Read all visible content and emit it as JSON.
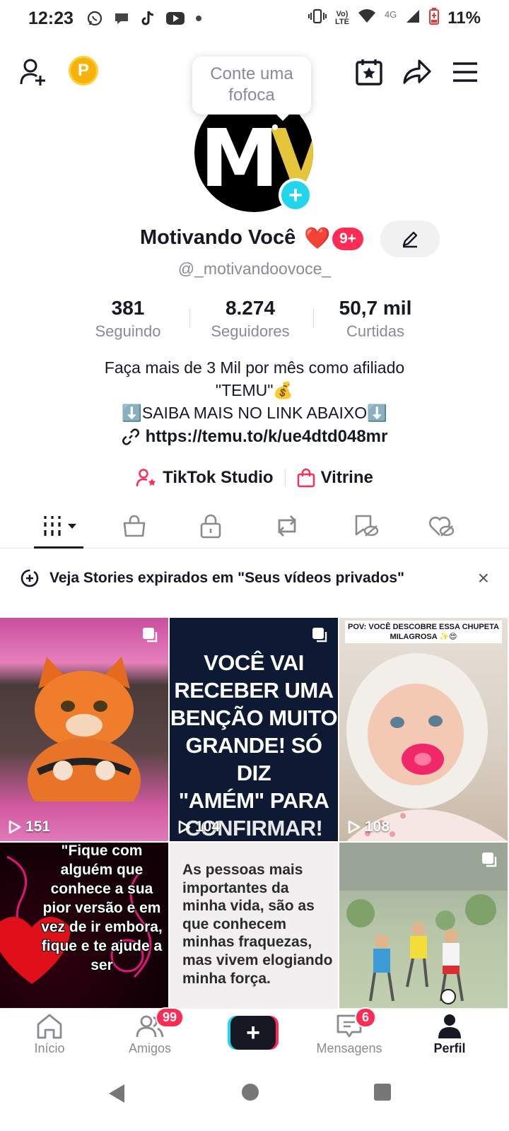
{
  "status_bar": {
    "time": "12:23",
    "network": "4G",
    "battery": "11%"
  },
  "header": {
    "tooltip": "Conte uma fofoca",
    "coin_letter": "P",
    "icons": [
      "add-user-icon",
      "coin-icon",
      "calendar-star-icon",
      "share-icon",
      "menu-icon"
    ]
  },
  "profile": {
    "avatar_letters": {
      "m": "M",
      "v": "V"
    },
    "name": "Motivando Você",
    "heart": "❤️",
    "badge": "9+",
    "username": "@_motivandoovoce_",
    "stats": [
      {
        "num": "381",
        "label": "Seguindo"
      },
      {
        "num": "8.274",
        "label": "Seguidores"
      },
      {
        "num": "50,7 mil",
        "label": "Curtidas"
      }
    ],
    "bio_line1": "Faça mais de 3 Mil por mês como afiliado",
    "bio_line2": "\"TEMU\"💰",
    "bio_line3": "⬇️SAIBA MAIS NO LINK ABAIXO⬇️",
    "link": "https://temu.to/k/ue4dtd048mr",
    "action_studio": "TikTok Studio",
    "action_vitrine": "Vitrine"
  },
  "banner": {
    "text": "Veja Stories expirados em \"Seus vídeos privados\"",
    "close": "×"
  },
  "videos": [
    {
      "views": "151"
    },
    {
      "views": "104",
      "text": [
        "VOCÊ VAI",
        "RECEBER UMA",
        "BENÇÃO MUITO",
        "GRANDE! SÓ DIZ",
        "\"AMÉM\" PARA",
        "CONFIRMAR! 🙏"
      ]
    },
    {
      "views": "108",
      "caption": "POV: VOCÊ DESCOBRE ESSA CHUPETA MILAGROSA ✨😍"
    },
    {
      "text": "\"Fique com alguém que conhece a sua pior versão e em vez de ir embora, fique e te ajude a ser"
    },
    {
      "text": "As pessoas mais importantes da minha vida, são as que conhecem minhas fraquezas, mas vivem elogiando minha força."
    },
    {}
  ],
  "bottom_nav": {
    "home": "Início",
    "friends": "Amigos",
    "friends_badge": "99",
    "create": "+",
    "messages": "Mensagens",
    "messages_badge": "6",
    "profile": "Perfil"
  }
}
